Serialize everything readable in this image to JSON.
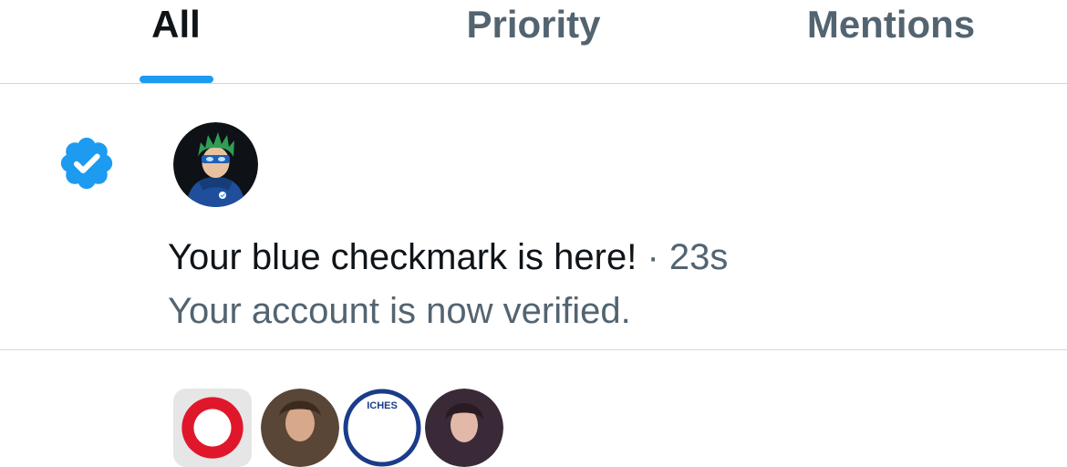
{
  "tabs": [
    {
      "label": "All",
      "active": true
    },
    {
      "label": "Priority",
      "active": false
    },
    {
      "label": "Mentions",
      "active": false
    }
  ],
  "accent_color": "#1d9bf0",
  "notification": {
    "icon": "verified-badge-icon",
    "avatar": "hooded-character-avatar",
    "title": "Your blue checkmark is here!",
    "separator": "·",
    "time": "23s",
    "body": "Your account is now verified."
  },
  "next_notification": {
    "avatars": [
      "app-logo-avatar",
      "person-avatar",
      "crest-avatar",
      "person-avatar-2"
    ],
    "crest_text": "ICHES"
  }
}
